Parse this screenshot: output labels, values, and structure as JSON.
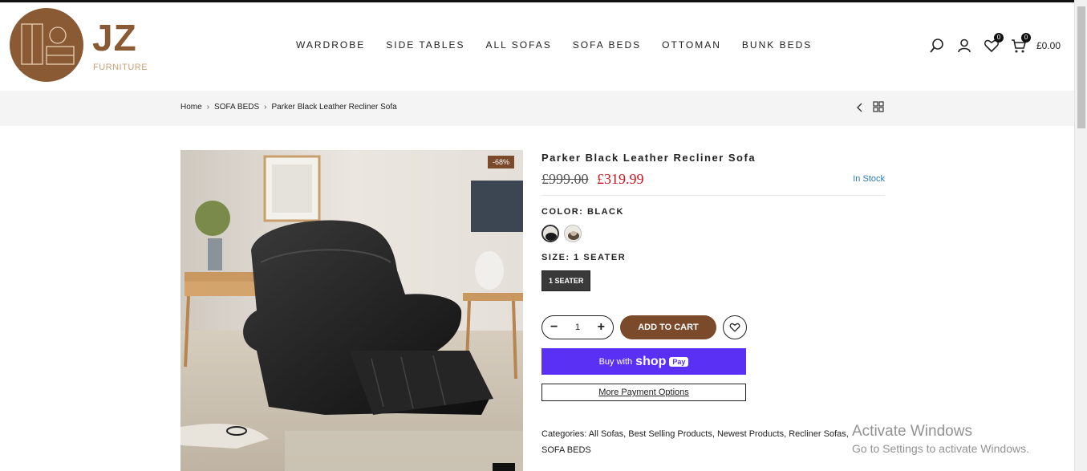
{
  "brand": {
    "name": "JZ",
    "tagline": "FURNITURE"
  },
  "nav": {
    "items": [
      "WARDROBE",
      "SIDE TABLES",
      "ALL SOFAS",
      "SOFA BEDS",
      "OTTOMAN",
      "BUNK BEDS"
    ]
  },
  "header_icons": {
    "wishlist_count": "0",
    "cart_count": "0",
    "cart_total": "£0.00",
    "icons": [
      "search-icon",
      "user-icon",
      "heart-icon",
      "cart-icon"
    ]
  },
  "breadcrumb": {
    "items": [
      "Home",
      "SOFA BEDS",
      "Parker Black Leather Recliner Sofa"
    ]
  },
  "product": {
    "discount_badge": "-68%",
    "title": "Parker Black Leather Recliner Sofa",
    "old_price": "£999.00",
    "new_price": "£319.99",
    "stock": "In Stock",
    "color_label": "COLOR: BLACK",
    "size_label": "SIZE: 1 SEATER",
    "size_option": "1 SEATER",
    "quantity": "1",
    "add_to_cart": "ADD TO CART",
    "buy_with": "Buy with",
    "shop_word": "shop",
    "pay_word": "Pay",
    "more_payment": "More Payment Options",
    "categories_label": "Categories:",
    "categories": [
      "All Sofas",
      "Best Selling Products",
      "Newest Products",
      "Recliner Sofas",
      "SOFA BEDS"
    ]
  },
  "watermark": {
    "line1": "Activate Windows",
    "line2": "Go to Settings to activate Windows."
  },
  "colors": {
    "brand_brown": "#8a5a34",
    "price_red": "#d0141e",
    "shoppay_purple": "#5a31f4",
    "stock_blue": "#2a7bb6"
  }
}
